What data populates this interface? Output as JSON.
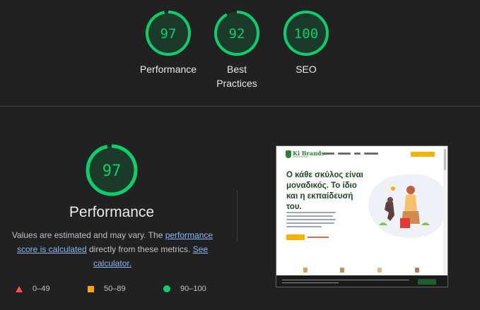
{
  "colors": {
    "pass": "#0cce6b",
    "average": "#ffa400",
    "fail": "#ff4e42",
    "background": "#212121",
    "link": "#8ab4f8"
  },
  "top_gauges": [
    {
      "score": "97",
      "label": "Performance",
      "fraction": 0.97
    },
    {
      "score": "92",
      "label": "Best Practices",
      "fraction": 0.92
    },
    {
      "score": "100",
      "label": "SEO",
      "fraction": 1.0
    }
  ],
  "performance": {
    "score": "97",
    "fraction": 0.97,
    "title": "Performance",
    "desc_prefix": "Values are estimated and may vary. The ",
    "desc_link1": "performance score is calculated",
    "desc_middle": " directly from these metrics. ",
    "desc_link2": "See calculator."
  },
  "legend": [
    {
      "icon": "triangle-fail-icon",
      "range": "0–49"
    },
    {
      "icon": "square-average-icon",
      "range": "50–89"
    },
    {
      "icon": "circle-pass-icon",
      "range": "90–100"
    }
  ],
  "thumbnail": {
    "logo": "Ki Brands",
    "nav_links_count": 4,
    "hero_text": "Ο κάθε σκύλος είναι μοναδικός. Το ίδιο και η εκπαίδευσή του."
  }
}
